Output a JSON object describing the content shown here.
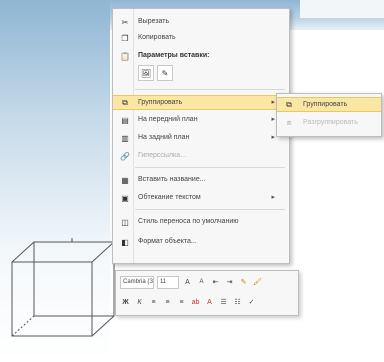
{
  "menu": {
    "items": [
      {
        "label": "Вырезать",
        "icon": "cut-icon"
      },
      {
        "label": "Копировать",
        "icon": "copy-icon"
      },
      {
        "label": "Параметры вставки:",
        "icon": "paste-icon"
      },
      {
        "label": "Группировать",
        "icon": "group-icon",
        "submenu": true
      },
      {
        "label": "На передний план",
        "icon": "bring-front-icon",
        "submenu": true
      },
      {
        "label": "На задний план",
        "icon": "send-back-icon",
        "submenu": true
      },
      {
        "label": "Гиперссылка...",
        "icon": "hyperlink-icon",
        "disabled": true
      },
      {
        "label": "Вставить название...",
        "icon": "caption-icon"
      },
      {
        "label": "Обтекание текстом",
        "icon": "wrap-text-icon",
        "submenu": true
      },
      {
        "label": "Стиль переноса по умолчанию",
        "icon": "default-style-icon"
      },
      {
        "label": "Формат объекта...",
        "icon": "format-object-icon"
      }
    ]
  },
  "submenu": {
    "items": [
      {
        "label": "Группировать",
        "icon": "group-icon",
        "disabled": false
      },
      {
        "label": "Разгруппировать",
        "icon": "ungroup-icon",
        "disabled": true
      }
    ]
  },
  "toolbar": {
    "font": "Cambria (З",
    "size": "11"
  },
  "colors": {
    "highlight": "#fbe7a4",
    "highlight_border": "#e9c768",
    "menu_bg": "#f7f7f7"
  }
}
